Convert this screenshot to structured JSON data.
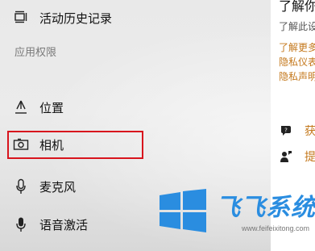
{
  "sidebar": {
    "top_item": {
      "label": "活动历史记录",
      "icon": "activity-history-icon"
    },
    "section_title": "应用权限",
    "items": [
      {
        "label": "位置",
        "icon": "location-icon"
      },
      {
        "label": "相机",
        "icon": "camera-icon"
      },
      {
        "label": "麦克风",
        "icon": "microphone-icon"
      },
      {
        "label": "语音激活",
        "icon": "voice-activation-icon"
      }
    ],
    "highlighted_item": "相机",
    "highlight_color": "#d8141d"
  },
  "content": {
    "heading": "了解你",
    "subtext": "了解此设",
    "links": [
      "了解更多",
      "隐私仪表",
      "隐私声明"
    ],
    "help_items": [
      {
        "label": "获",
        "icon": "help-chat-icon"
      },
      {
        "label": "提",
        "icon": "feedback-person-icon"
      }
    ],
    "link_color": "#c4781c"
  },
  "watermark": {
    "text": "飞飞系统",
    "url": "www.feifeixitong.com",
    "color": "#2a8de0"
  }
}
